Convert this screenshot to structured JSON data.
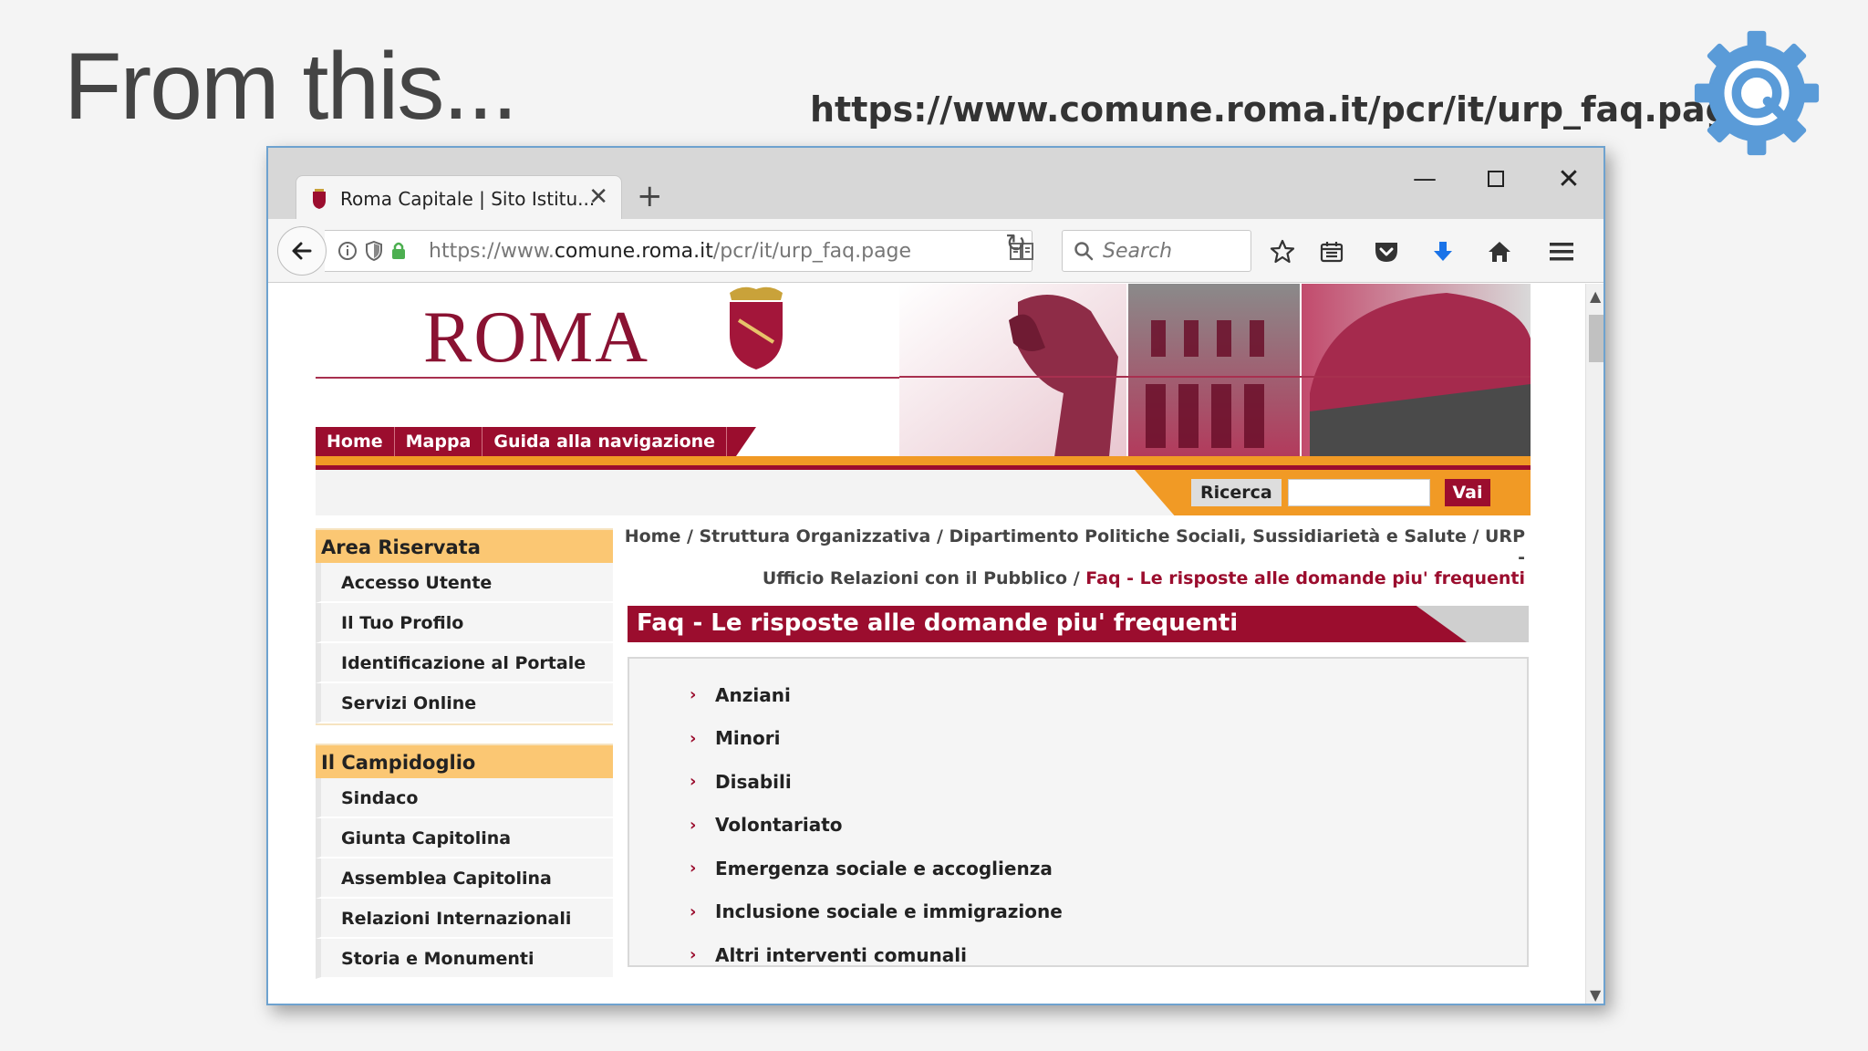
{
  "slide": {
    "title": "From this...",
    "url": "https://www.comune.roma.it/pcr/it/urp_faq.page",
    "logo_icon": "gear-refresh-icon"
  },
  "browser": {
    "tab_title": "Roma Capitale | Sito Istitu...",
    "url_prefix": "https://www.",
    "url_host": "comune.roma.it",
    "url_path": "/pcr/it/urp_faq.page",
    "search_placeholder": "Search"
  },
  "site": {
    "logo_text": "ROMA",
    "topnav": [
      "Home",
      "Mappa",
      "Guida alla navigazione"
    ],
    "search": {
      "label": "Ricerca",
      "button": "Vai"
    },
    "sidebar": [
      {
        "heading": "Area Riservata",
        "items": [
          "Accesso Utente",
          "Il Tuo Profilo",
          "Identificazione al Portale",
          "Servizi Online"
        ]
      },
      {
        "heading": "Il Campidoglio",
        "items": [
          "Sindaco",
          "Giunta Capitolina",
          "Assemblea Capitolina",
          "Relazioni Internazionali",
          "Storia e Monumenti"
        ]
      }
    ],
    "breadcrumb": {
      "line1": "Home / Struttura Organizzativa / Dipartimento Politiche Sociali, Sussidiarietà e Salute / URP -",
      "line2_prefix": "Ufficio Relazioni con il Pubblico / ",
      "current": "Faq - Le risposte alle domande piu' frequenti"
    },
    "page_title": "Faq - Le risposte alle domande piu' frequenti",
    "faq_items": [
      "Anziani",
      "Minori",
      "Disabili",
      "Volontariato",
      "Emergenza sociale e accoglienza",
      "Inclusione sociale e immigrazione",
      "Altri interventi comunali"
    ]
  },
  "colors": {
    "brand_red": "#9b0d2e",
    "accent_orange": "#f19a25",
    "sidebar_head": "#fbc773"
  }
}
